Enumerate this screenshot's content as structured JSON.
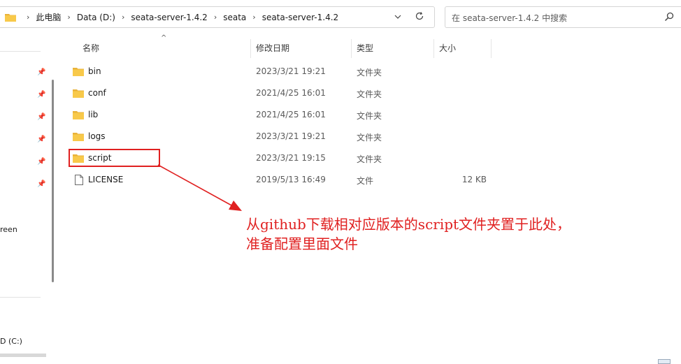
{
  "address_bar": {
    "breadcrumbs": [
      "此电脑",
      "Data (D:)",
      "seata-server-1.4.2",
      "seata",
      "seata-server-1.4.2"
    ]
  },
  "search": {
    "placeholder": "在 seata-server-1.4.2 中搜索"
  },
  "nav": {
    "partial_item": "reen",
    "drive_label": "D (C:)"
  },
  "columns": {
    "name": "名称",
    "modified": "修改日期",
    "type": "类型",
    "size": "大小"
  },
  "files": [
    {
      "name": "bin",
      "modified": "2023/3/21 19:21",
      "type": "文件夹",
      "size": "",
      "kind": "folder"
    },
    {
      "name": "conf",
      "modified": "2021/4/25 16:01",
      "type": "文件夹",
      "size": "",
      "kind": "folder"
    },
    {
      "name": "lib",
      "modified": "2021/4/25 16:01",
      "type": "文件夹",
      "size": "",
      "kind": "folder"
    },
    {
      "name": "logs",
      "modified": "2023/3/21 19:21",
      "type": "文件夹",
      "size": "",
      "kind": "folder"
    },
    {
      "name": "script",
      "modified": "2023/3/21 19:15",
      "type": "文件夹",
      "size": "",
      "kind": "folder"
    },
    {
      "name": "LICENSE",
      "modified": "2019/5/13 16:49",
      "type": "文件",
      "size": "12 KB",
      "kind": "file"
    }
  ],
  "annotation": {
    "line1": "从github下载相对应版本的script文件夹置于此处，",
    "line2": "准备配置里面文件",
    "color": "#e02020"
  },
  "colors": {
    "folder": "#f8c94a",
    "folder_dark": "#e9b23a",
    "accent_red": "#e02020"
  }
}
